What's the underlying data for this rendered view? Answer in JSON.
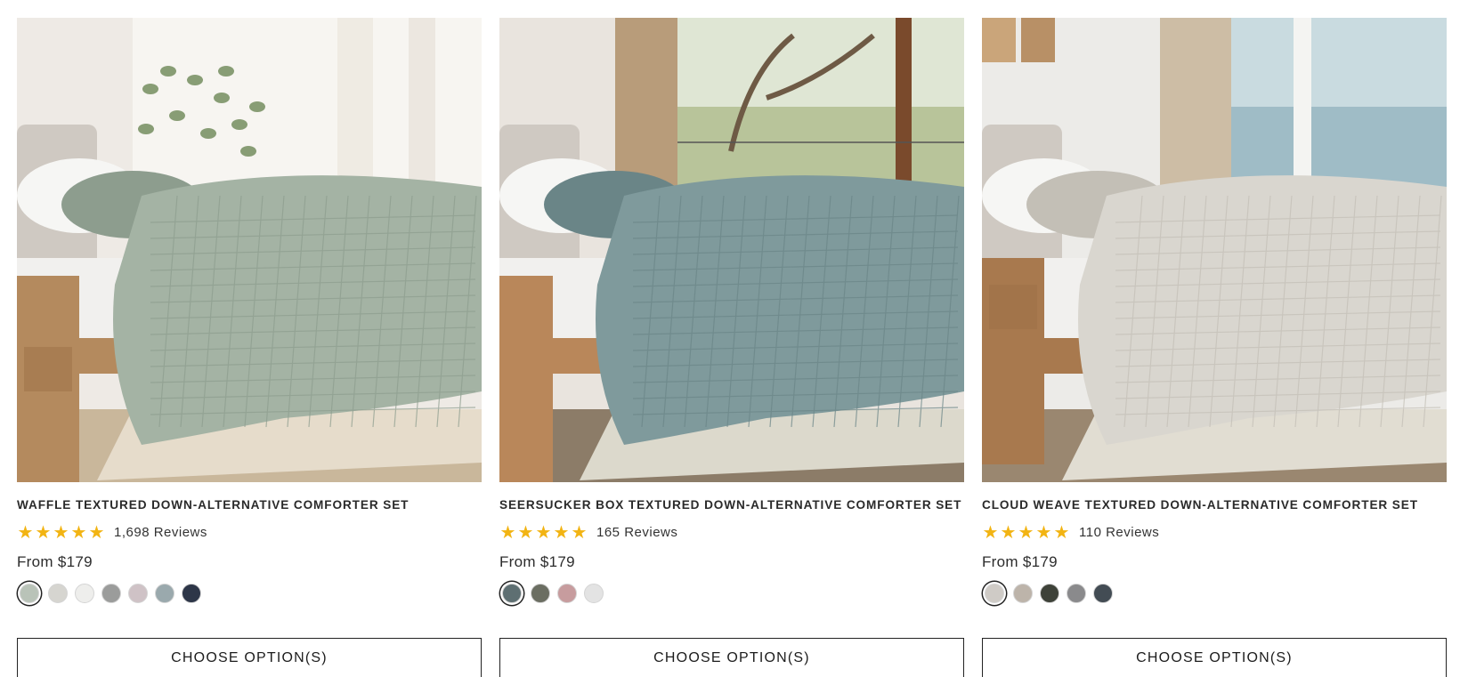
{
  "products": [
    {
      "title": "WAFFLE TEXTURED DOWN-ALTERNATIVE COMFORTER SET",
      "reviews": "1,698 Reviews",
      "price": "From $179",
      "cta": "CHOOSE OPTION(S)",
      "image_alt": "Waffle textured comforter on a bed in a bright bedroom",
      "rating_stars": 5,
      "swatches": [
        "#b9c3b8",
        "#d6d5d0",
        "#eeeeec",
        "#9b9c9b",
        "#cfc2c6",
        "#9aa9ad",
        "#2d3648"
      ],
      "selected_swatch": 0,
      "palette": {
        "wall": "#eeeae5",
        "window": "#f7f5f1",
        "comforter": "#a4b3a4",
        "comforter_dark": "#8d9d8e",
        "floor": "#c9b79b",
        "rug": "#e6dccb",
        "wood": "#b48a5e"
      }
    },
    {
      "title": "SEERSUCKER BOX TEXTURED DOWN-ALTERNATIVE COMFORTER SET",
      "reviews": "165 Reviews",
      "price": "From $179",
      "cta": "CHOOSE OPTION(S)",
      "image_alt": "Seersucker box textured comforter on a bed beside a large window",
      "rating_stars": 5,
      "swatches": [
        "#5e6f72",
        "#6b6e62",
        "#c79c9e",
        "#e3e3e3"
      ],
      "selected_swatch": 0,
      "palette": {
        "wall": "#e9e4de",
        "window": "#b8c49a",
        "comforter": "#7f9a9c",
        "comforter_dark": "#6a8587",
        "floor": "#8c7c68",
        "rug": "#dcd9cc",
        "wood": "#b9875a"
      }
    },
    {
      "title": "CLOUD WEAVE TEXTURED DOWN-ALTERNATIVE COMFORTER SET",
      "reviews": "110 Reviews",
      "price": "From $179",
      "cta": "CHOOSE OPTION(S)",
      "image_alt": "Cloud weave textured comforter on a bed with ocean view",
      "rating_stars": 5,
      "swatches": [
        "#cfcbc6",
        "#bdb4aa",
        "#3e4239",
        "#8a8a8c",
        "#434c54"
      ],
      "selected_swatch": 0,
      "palette": {
        "wall": "#ecebe8",
        "window": "#c9dbe0",
        "comforter": "#d9d6cf",
        "comforter_dark": "#c3bfb6",
        "floor": "#9a8770",
        "rug": "#e1ddd2",
        "wood": "#a8794e"
      }
    }
  ]
}
